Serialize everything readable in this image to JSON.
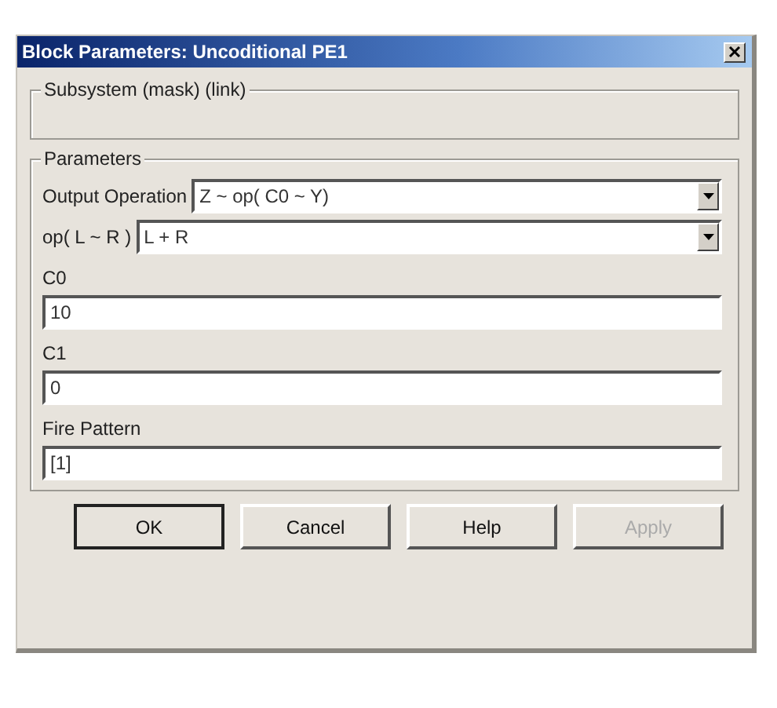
{
  "window": {
    "title": "Block Parameters: Uncoditional PE1"
  },
  "description_group": {
    "title": "Subsystem (mask) (link)"
  },
  "parameters_group": {
    "title": "Parameters",
    "fields": [
      {
        "kind": "dropdown",
        "label": "Output Operation",
        "value": "Z ~ op( C0 ~ Y)"
      },
      {
        "kind": "dropdown",
        "label": "op( L ~ R )",
        "value": "L + R"
      },
      {
        "kind": "text",
        "label": "C0",
        "value": "10"
      },
      {
        "kind": "text",
        "label": "C1",
        "value": "0"
      },
      {
        "kind": "text",
        "label": "Fire Pattern",
        "value": "[1]"
      }
    ]
  },
  "buttons": [
    {
      "label": "OK",
      "default": true,
      "disabled": false
    },
    {
      "label": "Cancel",
      "default": false,
      "disabled": false
    },
    {
      "label": "Help",
      "default": false,
      "disabled": false
    },
    {
      "label": "Apply",
      "default": false,
      "disabled": true
    }
  ]
}
